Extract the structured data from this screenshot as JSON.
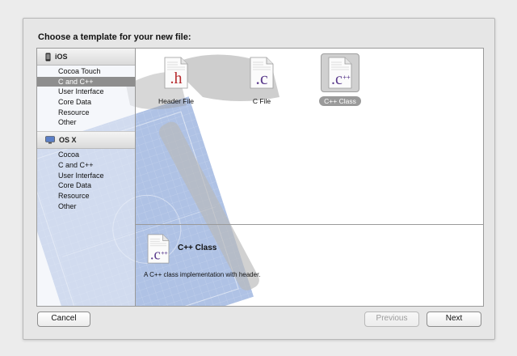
{
  "dialog": {
    "title": "Choose a template for your new file:"
  },
  "sidebar": {
    "sections": [
      {
        "name": "iOS",
        "icon": "iphone-icon",
        "items": [
          "Cocoa Touch",
          "C and C++",
          "User Interface",
          "Core Data",
          "Resource",
          "Other"
        ]
      },
      {
        "name": "OS X",
        "icon": "finder-icon",
        "items": [
          "Cocoa",
          "C and C++",
          "User Interface",
          "Core Data",
          "Resource",
          "Other"
        ]
      }
    ],
    "selected": "iOS / C and C++"
  },
  "templates": [
    {
      "label": "Header File",
      "icon": "header-file-icon",
      "glyph": ".h",
      "glyph_color": "#b6292c"
    },
    {
      "label": "C File",
      "icon": "c-file-icon",
      "glyph": ".c",
      "glyph_color": "#5a3a8c"
    },
    {
      "label": "C++ Class",
      "icon": "cpp-file-icon",
      "glyph": ".c++",
      "glyph_color": "#5a3a8c"
    }
  ],
  "selected_template": "C++ Class",
  "detail": {
    "title": "C++ Class",
    "description": "A C++ class implementation with header.",
    "icon": "cpp-file-icon"
  },
  "buttons": {
    "cancel": "Cancel",
    "previous": "Previous",
    "next": "Next"
  },
  "colors": {
    "selection": "#8e8e8e",
    "h_glyph": "#b6292c",
    "c_glyph": "#5a3a8c"
  }
}
